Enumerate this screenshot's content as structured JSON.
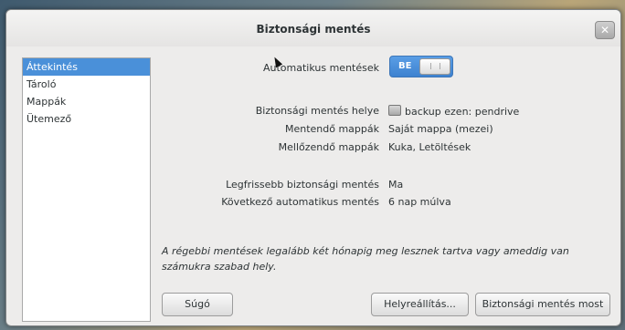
{
  "window": {
    "title": "Biztonsági mentés"
  },
  "sidebar": {
    "items": [
      {
        "label": "Áttekintés",
        "selected": true
      },
      {
        "label": "Tároló"
      },
      {
        "label": "Mappák"
      },
      {
        "label": "Ütemező"
      }
    ]
  },
  "overview": {
    "auto_backup_label": "Automatikus mentések",
    "auto_backup_toggle": "BE",
    "location_label": "Biztonsági mentés helye",
    "location_value": "backup ezen: pendrive",
    "include_label": "Mentendő mappák",
    "include_value": "Saját mappa (mezei)",
    "exclude_label": "Mellőzendő mappák",
    "exclude_value": "Kuka, Letöltések",
    "latest_label": "Legfrissebb biztonsági mentés",
    "latest_value": "Ma",
    "next_label": "Következő automatikus mentés",
    "next_value": "6 nap múlva",
    "note": "A régebbi mentések legalább két hónapig meg lesznek tartva vagy ameddig van számukra szabad hely."
  },
  "buttons": {
    "help": "Súgó",
    "restore": "Helyreállítás...",
    "backup_now": "Biztonsági mentés most"
  },
  "colors": {
    "accent": "#4a90d9"
  }
}
